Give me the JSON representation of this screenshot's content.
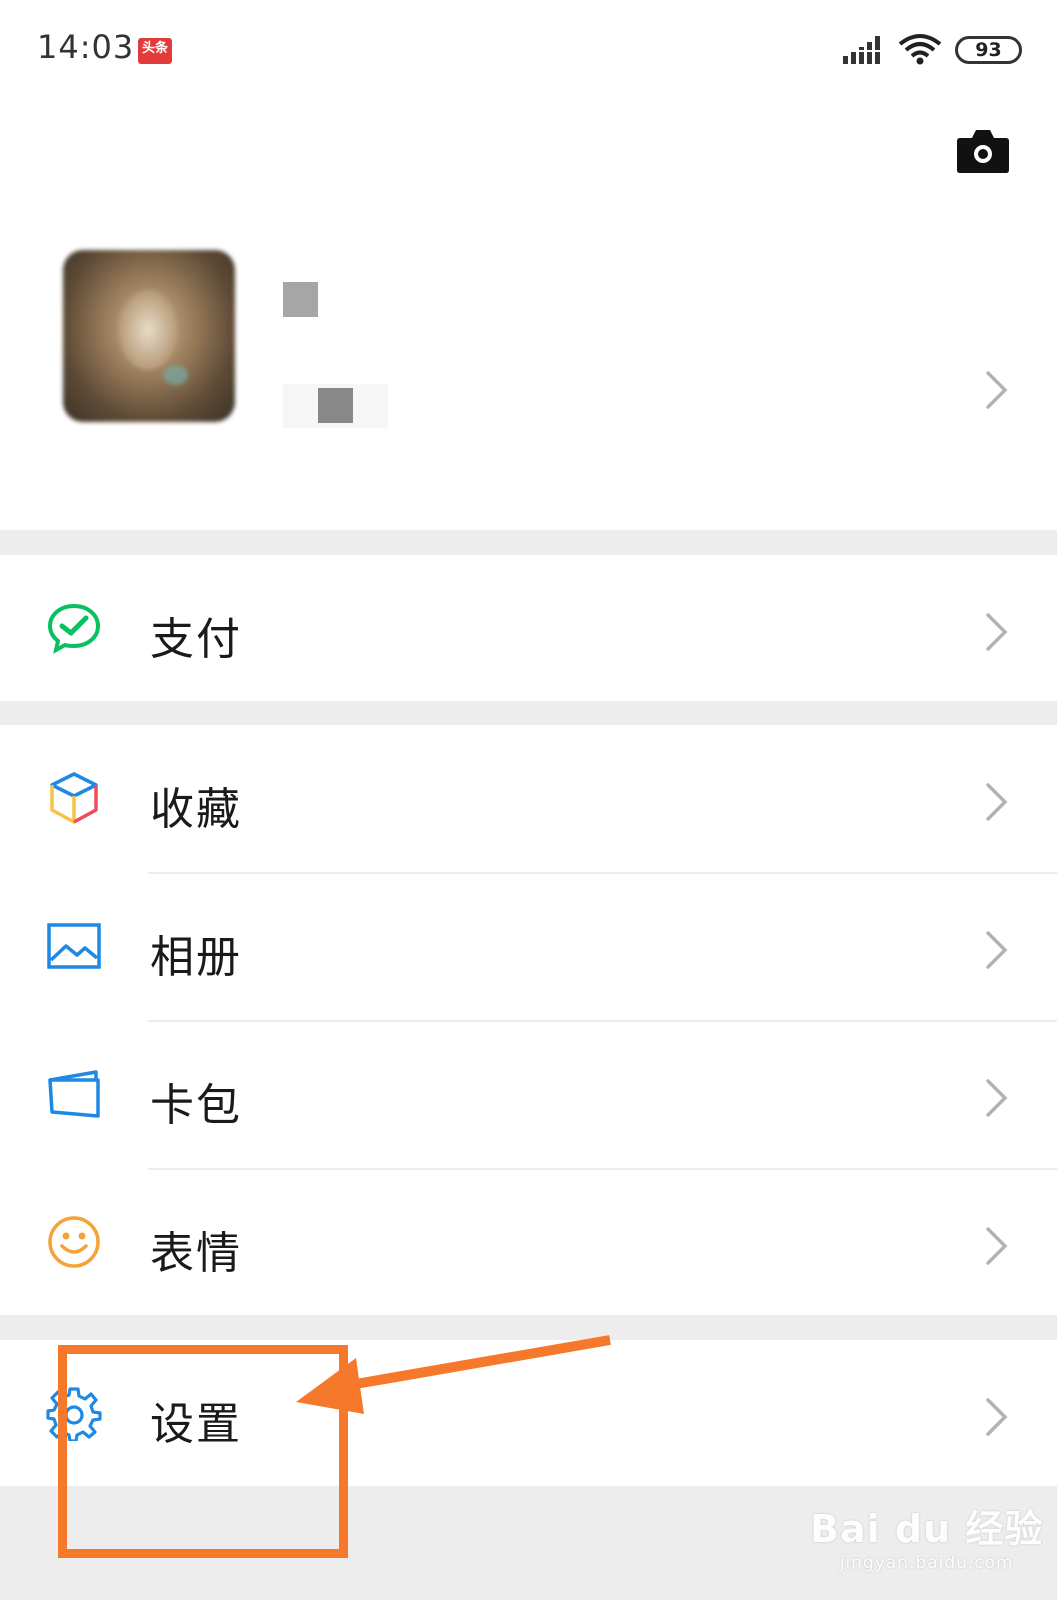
{
  "status_bar": {
    "time": "14:03",
    "app_badge": "头条",
    "battery": "93",
    "icons": [
      "signal-icon",
      "wifi-icon",
      "battery-icon"
    ]
  },
  "profile": {
    "camera_icon": "camera-icon",
    "chevron_icon": "chevron-right-icon"
  },
  "menu": {
    "pay": {
      "label": "支付",
      "icon": "wechat-pay-icon",
      "color": "#07c160"
    },
    "favorites": {
      "label": "收藏",
      "icon": "cube-icon"
    },
    "album": {
      "label": "相册",
      "icon": "photo-album-icon",
      "color": "#1e88e5"
    },
    "cards": {
      "label": "卡包",
      "icon": "card-wallet-icon",
      "color": "#1e88e5"
    },
    "stickers": {
      "label": "表情",
      "icon": "smiley-icon",
      "color": "#f4a33b"
    },
    "settings": {
      "label": "设置",
      "icon": "gear-icon",
      "color": "#1e88e5"
    }
  },
  "annotation": {
    "color": "#f6792b"
  },
  "watermark": {
    "main": "Bai du 经验",
    "sub": "jingyan.baidu.com"
  }
}
